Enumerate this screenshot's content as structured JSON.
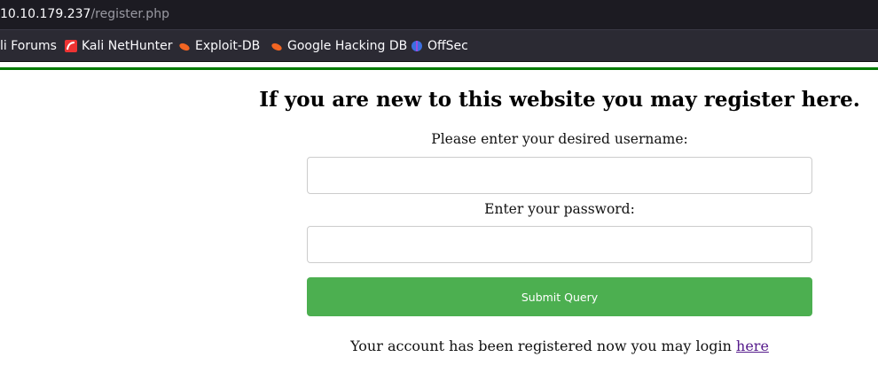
{
  "browser": {
    "url_host": "10.10.179.237",
    "url_path": "/register.php",
    "bookmarks": [
      {
        "label": "li Forums"
      },
      {
        "label": "Kali NetHunter",
        "icon": "nethunter-icon"
      },
      {
        "label": "Exploit-DB",
        "icon": "exploitdb-icon"
      },
      {
        "label": "Google Hacking DB",
        "icon": "exploitdb-icon"
      },
      {
        "label": "OffSec",
        "icon": "offsec-icon"
      }
    ]
  },
  "page": {
    "heading": "If you are new to this website you may register here.",
    "username_label": "Please enter your desired username:",
    "username_value": "",
    "password_label": "Enter your password:",
    "password_value": "",
    "submit_label": "Submit Query",
    "message": "Your account has been registered now you may login ",
    "link_label": "here"
  },
  "colors": {
    "accent_line": "#007a00",
    "button": "#4caf50"
  }
}
